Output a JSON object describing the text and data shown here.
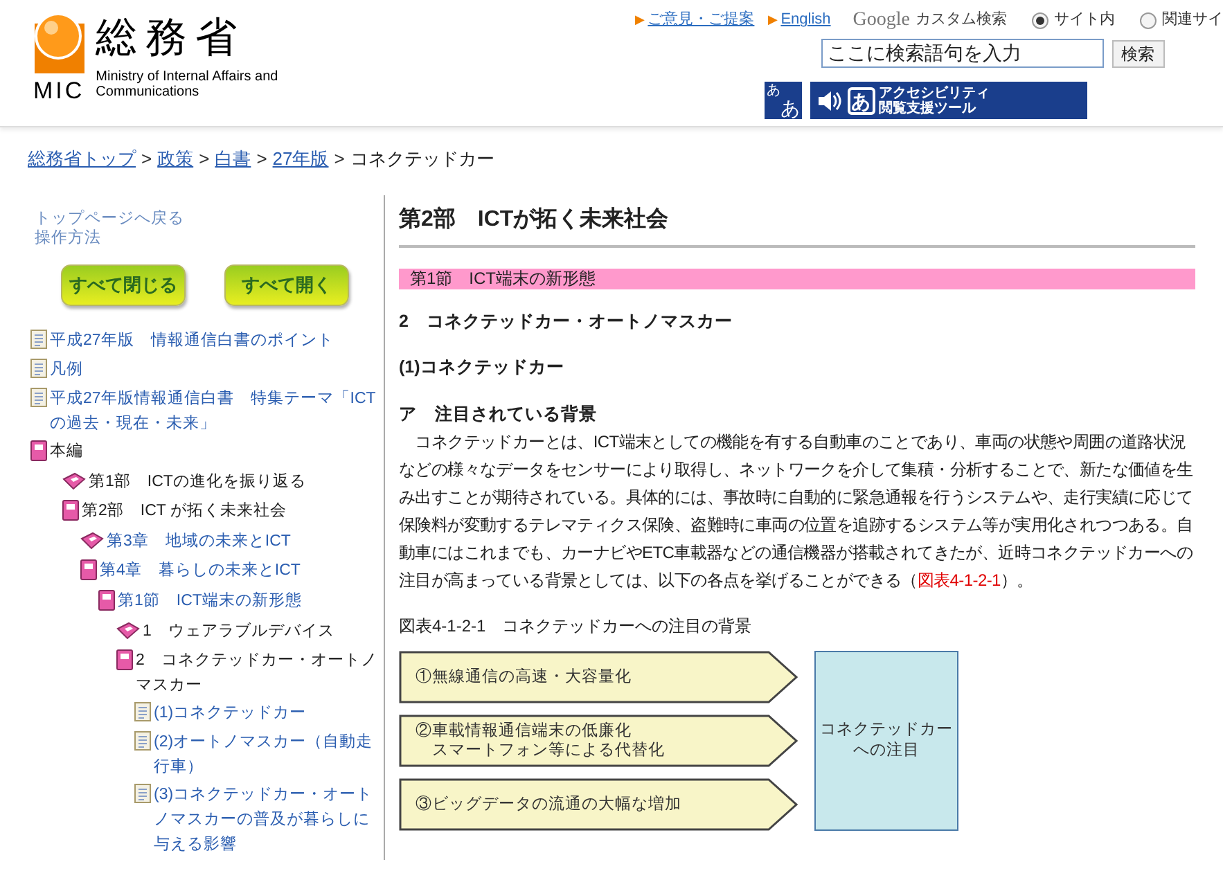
{
  "header": {
    "logo": {
      "name": "総務省",
      "abbr": "MIC",
      "english": "Ministry of Internal Affairs and Communications"
    },
    "links": [
      {
        "label": "ご意見・ご提案",
        "bullet": "▶"
      },
      {
        "label": "English",
        "bullet": "▶"
      }
    ],
    "search": {
      "brand": "Google",
      "brand_suffix": "カスタム検索",
      "scopes": [
        {
          "label": "サイト内",
          "selected": true
        },
        {
          "label": "関連サイ",
          "selected": false
        }
      ],
      "placeholder": "ここに検索語句を入力",
      "button": "検索"
    },
    "font_size_button": {
      "small": "あ",
      "large": "あ"
    },
    "accessibility_button": {
      "glyph": "あ",
      "line1": "アクセシビリティ",
      "line2": "閲覧支援ツール"
    }
  },
  "breadcrumb": [
    {
      "label": "総務省トップ",
      "link": true
    },
    {
      "separator": ">",
      "label": "政策",
      "link": true
    },
    {
      "separator": ">",
      "label": "白書",
      "link": true
    },
    {
      "separator": ">",
      "label": "27年版",
      "link": true
    },
    {
      "separator": ">",
      "label": "コネクテッドカー",
      "link": false
    }
  ],
  "sidebar": {
    "links": [
      "トップページへ戻る",
      "操作方法"
    ],
    "buttons": [
      "すべて閉じる",
      "すべて開く"
    ],
    "tree": [
      {
        "label": "平成27年版　情報通信白書のポイント",
        "kind": "page",
        "linked": true
      },
      {
        "label": "凡例",
        "kind": "page",
        "linked": true
      },
      {
        "label": "平成27年版情報通信白書　特集テーマ「ICTの過去・現在・未来」",
        "kind": "page",
        "linked": true
      },
      {
        "label": "本編",
        "kind": "book",
        "linked": false,
        "children": [
          {
            "label": "第1部　ICTの進化を振り返る",
            "kind": "closed-book",
            "linked": false
          },
          {
            "label": "第2部　ICT が拓く未来社会",
            "kind": "book",
            "linked": false,
            "children": [
              {
                "label": "第3章　地域の未来とICT",
                "kind": "closed-book",
                "linked": true
              },
              {
                "label": "第4章　暮らしの未来とICT",
                "kind": "book",
                "linked": true,
                "children": [
                  {
                    "label": "第1節　ICT端末の新形態",
                    "kind": "book",
                    "linked": true,
                    "children": [
                      {
                        "label": "1　ウェアラブルデバイス",
                        "kind": "closed-book",
                        "linked": false
                      },
                      {
                        "label": "2　コネクテッドカー・オートノマスカー",
                        "kind": "book",
                        "linked": false,
                        "children": [
                          {
                            "label": "(1)コネクテッドカー",
                            "kind": "page",
                            "linked": true
                          },
                          {
                            "label": "(2)オートノマスカー（自動走行車）",
                            "kind": "page",
                            "linked": true
                          },
                          {
                            "label": "(3)コネクテッドカー・オートノマスカーの普及が暮らしに与える影響",
                            "kind": "page",
                            "linked": true
                          }
                        ]
                      }
                    ]
                  }
                ]
              }
            ]
          }
        ]
      }
    ]
  },
  "main": {
    "title": "第2部　ICTが拓く未来社会",
    "section_band": "第1節　ICT端末の新形態",
    "heading": "2　コネクテッドカー・オートノマスカー",
    "subheading": "(1)コネクテッドカー",
    "topic": "ア　注目されている背景",
    "paragraph": "　コネクテッドカーとは、ICT端末としての機能を有する自動車のことであり、車両の状態や周囲の道路状況などの様々なデータをセンサーにより取得し、ネットワークを介して集積・分析することで、新たな価値を生み出すことが期待されている。具体的には、事故時に自動的に緊急通報を行うシステムや、走行実績に応じて保険料が変動するテレマティクス保険、盗難時に車両の位置を追跡するシステム等が実用化されつつある。自動車にはこれまでも、カーナビやETC車載器などの通信機器が搭載されてきたが、近時コネクテッドカーへの注目が高まっている背景としては、以下の各点を挙げることができる（",
    "paragraph_link": "図表4-1-2-1",
    "paragraph_end": "）。",
    "figure": {
      "caption": "図表4-1-2-1　コネクテッドカーへの注目の背景",
      "factors": [
        [
          "①無線通信の高速・大容量化"
        ],
        [
          "②車載情報通信端末の低廉化",
          "　スマートフォン等による代替化"
        ],
        [
          "③ビッグデータの流通の大幅な増加"
        ]
      ],
      "target": [
        "コネクテッドカー",
        "への注目"
      ]
    }
  }
}
